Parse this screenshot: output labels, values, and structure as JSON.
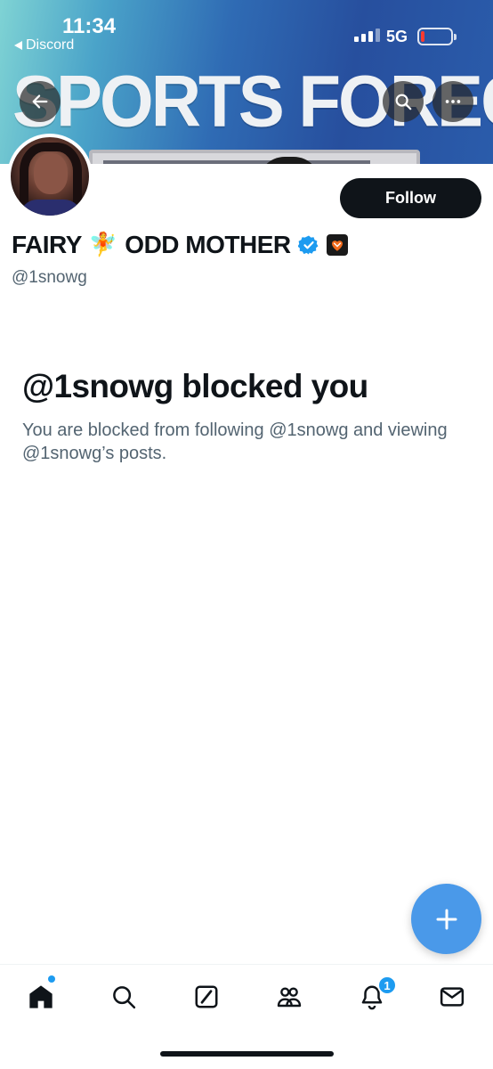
{
  "status_bar": {
    "time": "11:34",
    "back_app": "Discord",
    "network": "5G"
  },
  "banner": {
    "text": "SPORTS FORECAST"
  },
  "header_buttons": {
    "back_icon": "arrow-left-icon",
    "search_icon": "search-icon",
    "more_icon": "more-horizontal-icon"
  },
  "profile": {
    "name_part1": "FAIRY",
    "fairy_emoji": "🧚",
    "name_part2": "ODD MOTHER",
    "handle": "@1snowg",
    "follow_label": "Follow",
    "verified": true
  },
  "blocked": {
    "title": "@1snowg blocked you",
    "description": "You are blocked from following @1snowg and viewing @1snowg’s posts."
  },
  "bottom_nav": {
    "items": [
      {
        "name": "home",
        "icon": "home-icon"
      },
      {
        "name": "search",
        "icon": "search-icon"
      },
      {
        "name": "grok",
        "icon": "grok-icon"
      },
      {
        "name": "communities",
        "icon": "communities-icon"
      },
      {
        "name": "notifications",
        "icon": "bell-icon"
      },
      {
        "name": "messages",
        "icon": "mail-icon"
      }
    ],
    "notification_count": "1"
  },
  "colors": {
    "accent": "#1d9bf0",
    "fab": "#4a99e9",
    "text_primary": "#0f1419",
    "text_secondary": "#536471"
  }
}
